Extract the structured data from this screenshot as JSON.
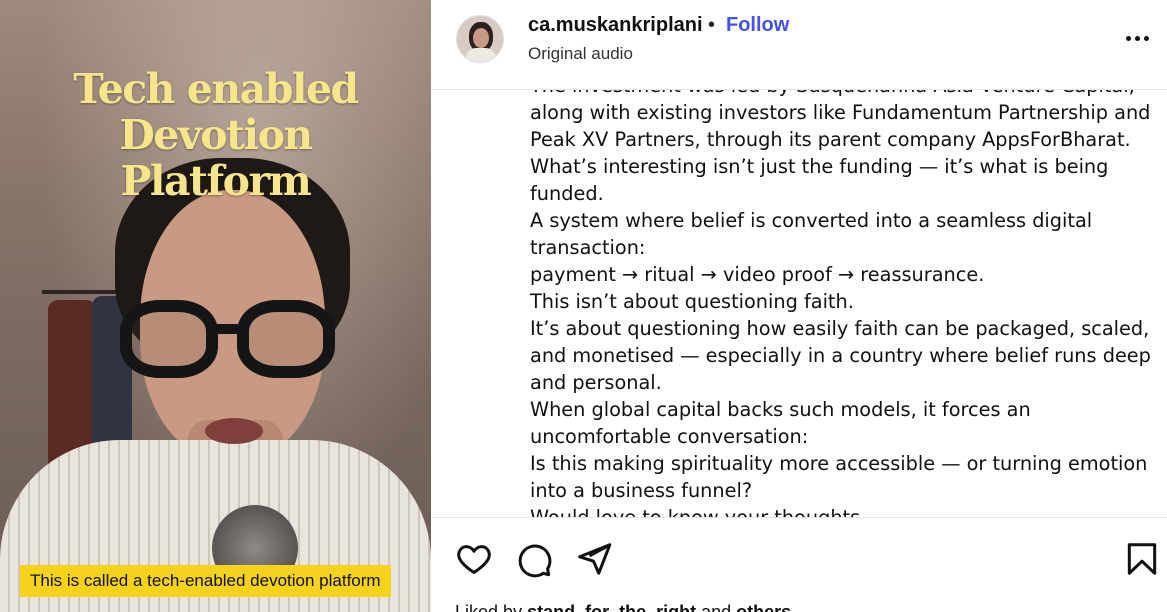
{
  "video": {
    "overlay_title_line1": "Tech enabled Devotion",
    "overlay_title_line2": "Platform",
    "caption": "This is called a tech-enabled devotion platform",
    "colors": {
      "title": "#f6e58a",
      "caption_bg": "#f6d21a"
    }
  },
  "header": {
    "username": "ca.muskankriplani",
    "separator": "•",
    "follow_label": "Follow",
    "audio": "Original audio",
    "more_icon": "more-horizontal-icon",
    "colors": {
      "follow": "#4150f7"
    }
  },
  "caption": {
    "lines": [
      "The investment was led by Susquehanna Asia Venture Capital,",
      "along with existing investors like Fundamentum Partnership and",
      "Peak XV Partners, through its parent company AppsForBharat.",
      "What’s interesting isn’t just the funding — it’s what is being",
      "funded.",
      "A system where belief is converted into a seamless digital",
      "transaction:",
      "payment → ritual → video proof → reassurance.",
      "This isn’t about questioning faith.",
      "It’s about questioning how easily faith can be packaged, scaled,",
      "and monetised — especially in a country where belief runs deep",
      "and personal.",
      "When global capital backs such models, it forces an",
      "uncomfortable conversation:",
      "Is this making spirituality more accessible — or turning emotion",
      "into a business funnel?",
      "Would love to know your thoughts."
    ]
  },
  "actions": {
    "icons": [
      "heart-icon",
      "comment-icon",
      "share-icon",
      "bookmark-icon"
    ],
    "liked_by_prefix": "Liked by",
    "liked_by_user": "stand_for_the_right",
    "liked_by_and": "and",
    "liked_by_others": "others"
  }
}
